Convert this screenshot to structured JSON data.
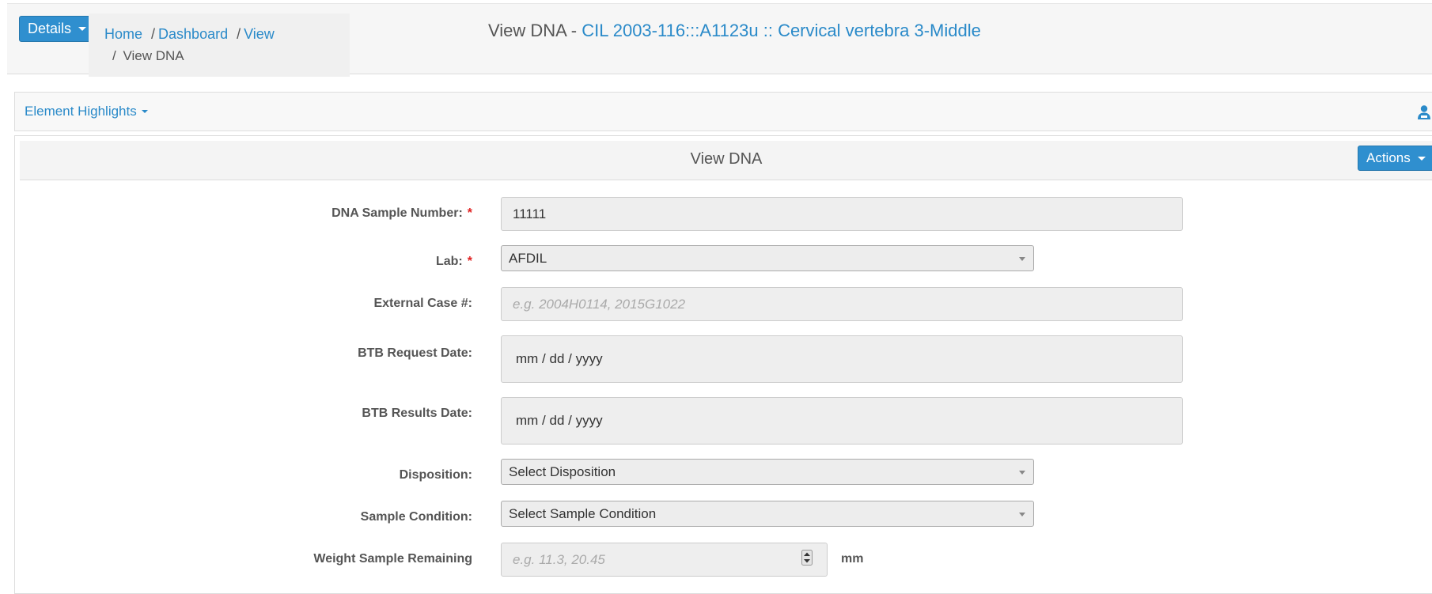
{
  "header": {
    "details_label": "Details",
    "breadcrumb": {
      "home": "Home",
      "dashboard": "Dashboard",
      "view": "View",
      "current": "View DNA",
      "separator": "/"
    },
    "title_prefix": "View DNA - ",
    "title_link": "CIL 2003-116:::A1123u :: Cervical vertebra 3-Middle"
  },
  "highlights": {
    "label": "Element Highlights",
    "user_icon": "user-icon"
  },
  "panel": {
    "title": "View DNA",
    "actions_label": "Actions"
  },
  "form": {
    "dna_sample_number": {
      "label": "DNA Sample Number:",
      "required": "*",
      "value": "11111"
    },
    "lab": {
      "label": "Lab:",
      "required": "*",
      "value": "AFDIL"
    },
    "external_case": {
      "label": "External Case #:",
      "placeholder": "e.g. 2004H0114, 2015G1022"
    },
    "btb_request_date": {
      "label": "BTB Request Date:",
      "value": "mm / dd / yyyy"
    },
    "btb_results_date": {
      "label": "BTB Results Date:",
      "value": "mm / dd / yyyy"
    },
    "disposition": {
      "label": "Disposition:",
      "value": "Select Disposition"
    },
    "sample_condition": {
      "label": "Sample Condition:",
      "value": "Select Sample Condition"
    },
    "weight_remaining": {
      "label": "Weight Sample Remaining",
      "placeholder": "e.g. 11.3, 20.45",
      "unit": "mm"
    }
  },
  "colors": {
    "accent": "#2f8fcf",
    "link": "#2a8ac9",
    "required": "#e02020"
  }
}
